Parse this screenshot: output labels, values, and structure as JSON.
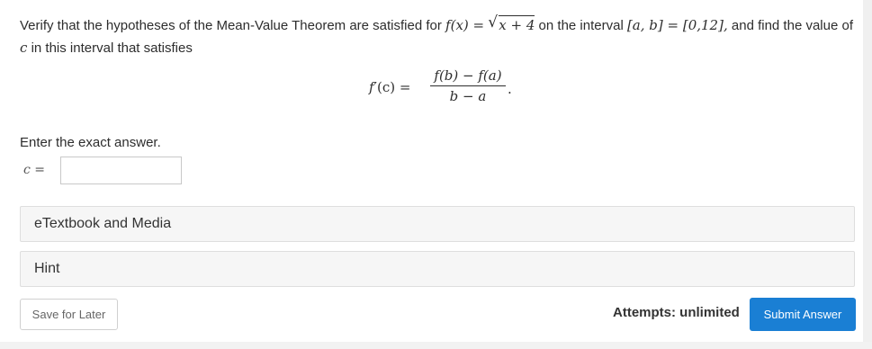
{
  "question": {
    "text_before": "Verify that the hypotheses of the Mean-Value Theorem are satisfied for ",
    "function_lhs": "f(x) =",
    "function_radicand": "x + 4",
    "text_on_interval": " on the interval ",
    "interval_expr": "[a, b] = [0,12],",
    "text_after": " and find the value of ",
    "c_var": "c",
    "text_end": " in this interval that satisfies"
  },
  "formula": {
    "lhs_f": "f",
    "lhs_prime": "′",
    "lhs_rest": "(c) =",
    "numerator": "f(b) − f(a)",
    "denominator": "b − a",
    "period": "."
  },
  "instruction": "Enter the exact answer.",
  "answer": {
    "label": "c =",
    "value": ""
  },
  "panels": {
    "etextbook": "eTextbook and Media",
    "hint": "Hint"
  },
  "footer": {
    "save_label": "Save for Later",
    "attempts": "Attempts: unlimited",
    "submit_label": "Submit Answer"
  },
  "colors": {
    "submit_bg": "#1a7fd4",
    "panel_bg": "#f6f6f6",
    "text": "#2d2d2d"
  }
}
